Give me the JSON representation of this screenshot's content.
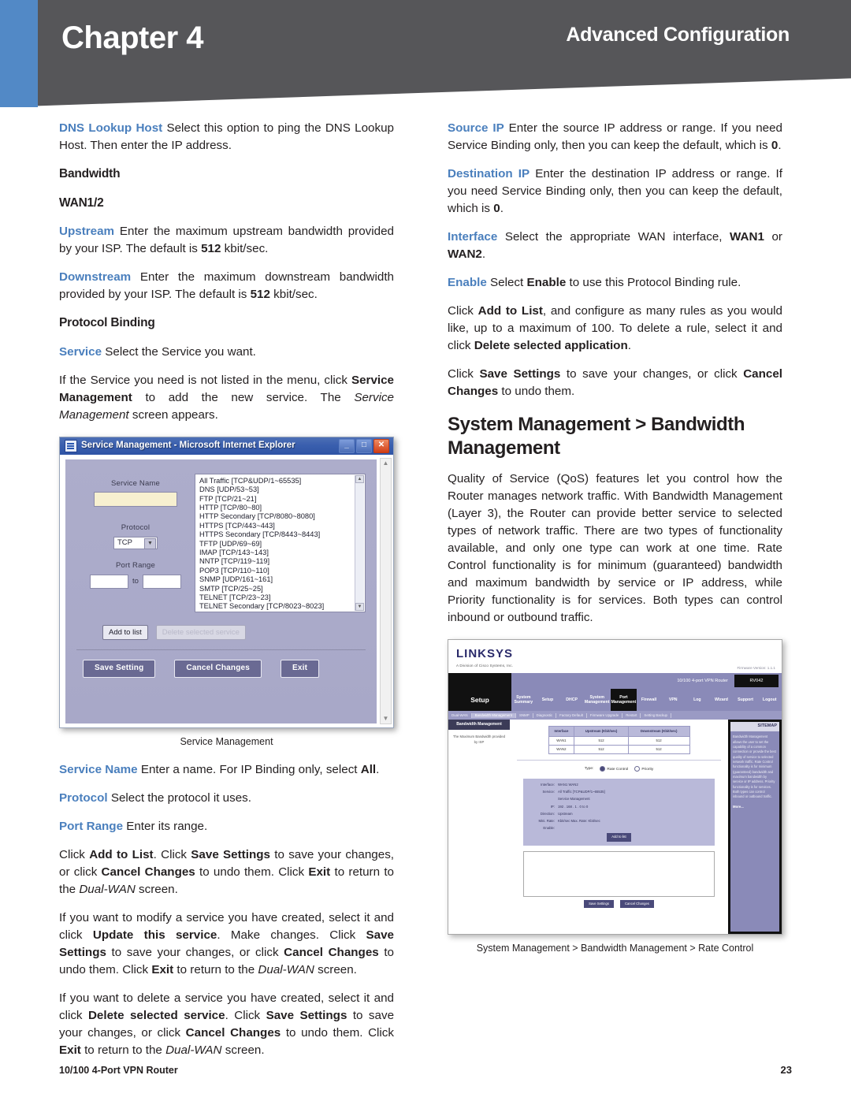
{
  "header": {
    "chapter": "Chapter 4",
    "section": "Advanced Configuration",
    "blue_stripe_color": "#5289c6",
    "banner_color": "#565659"
  },
  "left_column": {
    "p_dns_term": "DNS Lookup Host",
    "p_dns_rest": " Select this option to ping the DNS Lookup Host. Then enter the IP address.",
    "h_bandwidth": "Bandwidth",
    "h_wan": "WAN1/2",
    "p_up_term": "Upstream",
    "p_up_a": " Enter the maximum upstream bandwidth provided by your ISP. The default is ",
    "p_up_b": "512",
    "p_up_c": " kbit/sec.",
    "p_down_term": "Downstream",
    "p_down_a": " Enter the maximum downstream bandwidth provided by your ISP. The default is ",
    "p_down_b": "512",
    "p_down_c": " kbit/sec.",
    "h_protocol_binding": "Protocol Binding",
    "p_service_term": "Service",
    "p_service_rest": "  Select the Service you want.",
    "p_notlisted_a": "If the Service you need is not listed in the menu, click ",
    "p_notlisted_b": "Service Management",
    "p_notlisted_c": " to add the new service. The ",
    "p_notlisted_d": "Service Management",
    "p_notlisted_e": " screen appears.",
    "figure_caption": "Service Management",
    "p_svcname_term": "Service Name",
    "p_svcname_a": "  Enter a name. For IP Binding only, select ",
    "p_svcname_b": "All",
    "p_svcname_c": ".",
    "p_protocol_term": "Protocol",
    "p_protocol_rest": "  Select the protocol it uses.",
    "p_portrange_term": "Port Range",
    "p_portrange_rest": "  Enter its range.",
    "p_click_a": "Click ",
    "p_click_b": "Add to List",
    "p_click_c": ". Click ",
    "p_click_d": "Save Settings",
    "p_click_e": " to save your changes, or click ",
    "p_click_f": "Cancel Changes",
    "p_click_g": " to undo them. Click ",
    "p_click_h": "Exit",
    "p_click_i": " to return to the ",
    "p_click_j": "Dual-WAN",
    "p_click_k": " screen.",
    "p_modify_a": "If you want to modify a service you have created, select it and click ",
    "p_modify_b": "Update this service",
    "p_modify_c": ". Make changes. Click ",
    "p_modify_d": "Save Settings",
    "p_modify_e": " to save your changes, or click ",
    "p_modify_f": "Cancel Changes",
    "p_modify_g": " to undo them. Click ",
    "p_modify_h": "Exit",
    "p_modify_i": " to return to the ",
    "p_modify_j": "Dual-WAN",
    "p_modify_k": " screen.",
    "p_delete_a": "If you want to delete a service you have created, select it and click ",
    "p_delete_b": "Delete selected service",
    "p_delete_c": ". Click ",
    "p_delete_d": "Save Settings",
    "p_delete_e": " to save your changes, or click ",
    "p_delete_f": "Cancel Changes",
    "p_delete_g": " to undo them. Click ",
    "p_delete_h": "Exit",
    "p_delete_i": " to return to the ",
    "p_delete_j": "Dual-WAN",
    "p_delete_k": " screen."
  },
  "service_dialog": {
    "window_title": "Service Management - Microsoft Internet Explorer",
    "minimize_glyph": "_",
    "maximize_glyph": "□",
    "close_glyph": "✕",
    "label_service_name": "Service Name",
    "label_protocol": "Protocol",
    "protocol_value": "TCP",
    "label_port_range": "Port Range",
    "port_to": "to",
    "services": [
      "All Traffic [TCP&UDP/1~65535]",
      "DNS [UDP/53~53]",
      "FTP [TCP/21~21]",
      "HTTP [TCP/80~80]",
      "HTTP Secondary [TCP/8080~8080]",
      "HTTPS [TCP/443~443]",
      "HTTPS Secondary [TCP/8443~8443]",
      "TFTP [UDP/69~69]",
      "IMAP [TCP/143~143]",
      "NNTP [TCP/119~119]",
      "POP3 [TCP/110~110]",
      "SNMP [UDP/161~161]",
      "SMTP [TCP/25~25]",
      "TELNET [TCP/23~23]",
      "TELNET Secondary [TCP/8023~8023]"
    ],
    "btn_add_to_list": "Add to list",
    "btn_delete_selected": "Delete selected service",
    "btn_save_setting": "Save Setting",
    "btn_cancel_changes": "Cancel Changes",
    "btn_exit": "Exit"
  },
  "right_column": {
    "p_source_term": "Source IP",
    "p_source_a": " Enter the source IP address or range. If you need Service Binding only, then you can keep the default, which is ",
    "p_source_b": "0",
    "p_source_c": ".",
    "p_dest_term": "Destination IP",
    "p_dest_a": "  Enter the destination IP address or range. If you need Service Binding only, then you can keep the default, which is ",
    "p_dest_b": "0",
    "p_dest_c": ".",
    "p_iface_term": "Interface",
    "p_iface_a": "  Select the appropriate WAN interface, ",
    "p_iface_b": "WAN1",
    "p_iface_c": " or ",
    "p_iface_d": "WAN2",
    "p_iface_e": ".",
    "p_enable_term": "Enable",
    "p_enable_a": "  Select ",
    "p_enable_b": "Enable",
    "p_enable_c": " to use this Protocol Binding rule.",
    "p_addlist_a": "Click ",
    "p_addlist_b": "Add to List",
    "p_addlist_c": ", and configure as many rules as you would like, up to a maximum of 100. To delete a rule, select it and click ",
    "p_addlist_d": "Delete selected application",
    "p_addlist_e": ".",
    "p_save_a": "Click ",
    "p_save_b": "Save Settings",
    "p_save_c": " to save your changes, or click ",
    "p_save_d": "Cancel Changes",
    "p_save_e": " to undo them.",
    "h_section": "System Management > Bandwidth Management",
    "p_qos": "Quality of Service (QoS) features let you control how the Router manages network traffic. With Bandwidth Management (Layer 3), the Router can provide better service to selected types of network traffic. There are two types of functionality available, and only one type can work at one time. Rate Control functionality is for minimum (guaranteed) bandwidth and maximum bandwidth by service or IP address, while Priority functionality is for services. Both types can control inbound or outbound traffic.",
    "figure_caption": "System Management > Bandwidth Management > Rate Control"
  },
  "router_ui": {
    "brand": "LINKSYS",
    "brand_sub": "A Division of Cisco Systems, Inc.",
    "firmware": "Firmware Version: 1.1.1",
    "model": "10/100 4-port VPN Router",
    "model_box": "RV042",
    "setup_label": "Setup",
    "tabs": [
      "System Summary",
      "Setup",
      "DHCP",
      "System Management",
      "Port Management",
      "Firewall",
      "VPN",
      "Log",
      "Wizard",
      "Support",
      "Logout"
    ],
    "subtabs": [
      "Dual-WAN",
      "Bandwidth Management",
      "SNMP",
      "Diagnostic",
      "Factory Default",
      "Firmware Upgrade",
      "Restart",
      "Setting Backup"
    ],
    "side_header": "Bandwidth Management",
    "side_text": "The Maximum Bandwidth provided by ISP",
    "table_headers": [
      "Interface",
      "Upstream (Kbit/sec)",
      "Downstream (Kbit/sec)"
    ],
    "table_rows": [
      [
        "WAN1",
        "512",
        "512"
      ],
      [
        "WAN2",
        "512",
        "512"
      ]
    ],
    "type_label": "Type:",
    "type_option_1": "Rate Control",
    "type_option_2": "Priority",
    "panel_rows": [
      {
        "label": "Interface:",
        "value": "WAN1   WAN2"
      },
      {
        "label": "Service:",
        "value": "All Traffic [TCP&UDP/1~65535]"
      },
      {
        "label": "",
        "value": "Service Management"
      },
      {
        "label": "IP:",
        "value": "192 . 168 . 1 . 0   to 0"
      },
      {
        "label": "Direction:",
        "value": "Upstream"
      },
      {
        "label": "Mini. Rate:",
        "value": "Kbit/sec   Max. Rate:   Kbit/sec"
      },
      {
        "label": "Enable:",
        "value": ""
      }
    ],
    "panel_button": "Add to list",
    "footer_buttons": [
      "Save Settings",
      "Cancel Changes"
    ],
    "help_header": "SITEMAP",
    "help_text": "Bandwidth Management allows the user to set the capability of a common connection or provide the best quality of service to selected network traffic. Rate Control functionality is for minimum (guaranteed) bandwidth and maximum bandwidth by service or IP address. Priority functionality is for services. Both types can control inbound or outbound traffic.",
    "help_more": "More..."
  },
  "footer": {
    "product": "10/100 4-Port VPN Router",
    "page_number": "23"
  }
}
